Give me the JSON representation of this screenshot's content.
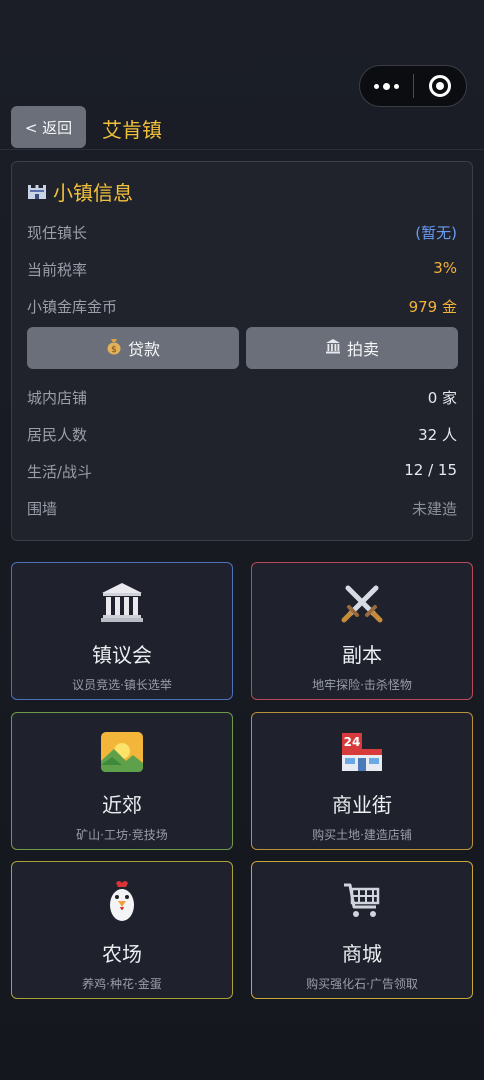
{
  "header": {
    "back_label": "< 返回",
    "title": "艾肯镇"
  },
  "capsule": {
    "more_icon": "more-dots-icon",
    "close_icon": "target-icon"
  },
  "info": {
    "title": "小镇信息",
    "title_icon": "castle-icon",
    "rows": [
      {
        "label": "现任镇长",
        "value": "(暂无)"
      },
      {
        "label": "当前税率",
        "value": "3%"
      },
      {
        "label": "小镇金库金币",
        "value": "979 金"
      },
      {
        "label": "城内店铺",
        "value": "0 家"
      },
      {
        "label": "居民人数",
        "value": "32 人"
      },
      {
        "label": "生活/战斗",
        "value": "12 / 15"
      },
      {
        "label": "围墙",
        "value": "未建造"
      }
    ],
    "loan_label": "贷款",
    "loan_icon": "money-bag-icon",
    "auction_label": "拍卖",
    "auction_icon": "bank-icon"
  },
  "tiles": [
    {
      "name": "镇议会",
      "sub": "议员竞选·镇长选举",
      "icon": "classical-building-icon",
      "border": "#4f6fbf"
    },
    {
      "name": "副本",
      "sub": "地牢探险·击杀怪物",
      "icon": "crossed-swords-icon",
      "border": "#b84a5a"
    },
    {
      "name": "近郊",
      "sub": "矿山·工坊·竞技场",
      "icon": "sunrise-landscape-icon",
      "border": "#6f9a4a"
    },
    {
      "name": "商业街",
      "sub": "购买土地·建造店铺",
      "icon": "convenience-store-icon",
      "border": "#b8923a"
    },
    {
      "name": "农场",
      "sub": "养鸡·种花·金蛋",
      "icon": "rooster-icon",
      "border": "#a9a23a"
    },
    {
      "name": "商城",
      "sub": "购买强化石·广告领取",
      "icon": "shopping-cart-icon",
      "border": "#c7a63a"
    }
  ]
}
